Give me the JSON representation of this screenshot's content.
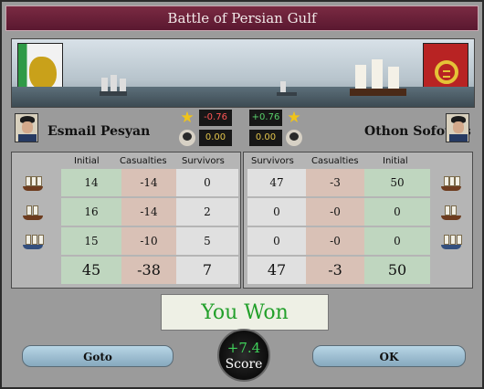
{
  "title": "Battle of Persian Gulf",
  "left": {
    "name": "Esmail Pesyan",
    "star_value": "-0.76",
    "general_value": "0.00",
    "headers": [
      "Initial",
      "Casualties",
      "Survivors"
    ],
    "rows": [
      {
        "initial": "14",
        "casualties": "-14",
        "survivors": "0"
      },
      {
        "initial": "16",
        "casualties": "-14",
        "survivors": "2"
      },
      {
        "initial": "15",
        "casualties": "-10",
        "survivors": "5"
      }
    ],
    "totals": {
      "initial": "45",
      "casualties": "-38",
      "survivors": "7"
    }
  },
  "right": {
    "name": "Othon Sofoulis",
    "star_value": "+0.76",
    "general_value": "0.00",
    "headers": [
      "Survivors",
      "Casualties",
      "Initial"
    ],
    "rows": [
      {
        "survivors": "47",
        "casualties": "-3",
        "initial": "50"
      },
      {
        "survivors": "0",
        "casualties": "-0",
        "initial": "0"
      },
      {
        "survivors": "0",
        "casualties": "-0",
        "initial": "0"
      }
    ],
    "totals": {
      "survivors": "47",
      "casualties": "-3",
      "initial": "50"
    }
  },
  "result": "You Won",
  "buttons": {
    "goto": "Goto",
    "ok": "OK"
  },
  "score": {
    "value": "+7.4",
    "label": "Score"
  },
  "colors": {
    "accent_red": "#7a2a42",
    "win_green": "#23a02b",
    "star_gold": "#f0c419"
  }
}
